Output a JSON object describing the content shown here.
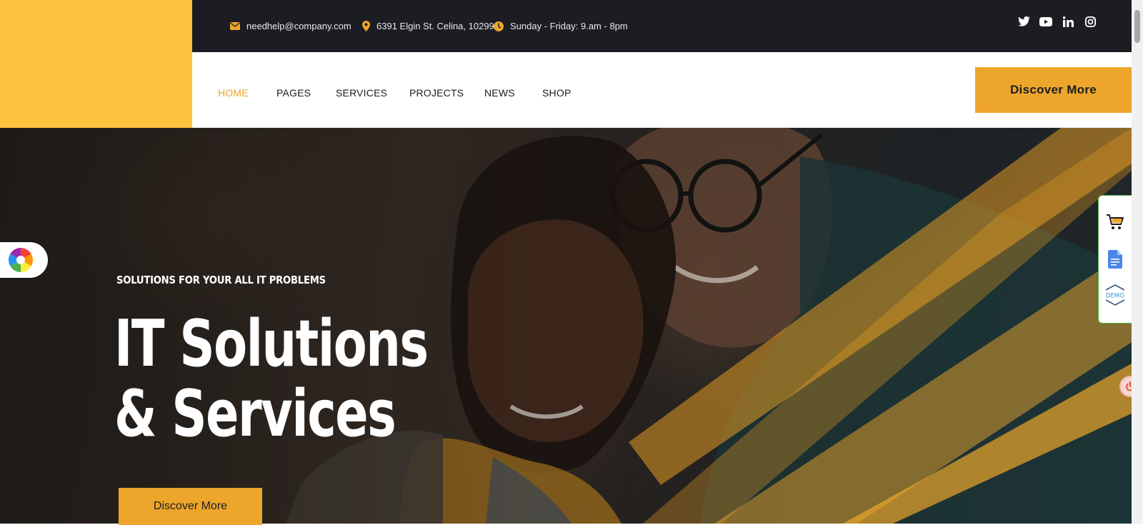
{
  "topbar": {
    "email": "needhelp@company.com",
    "address": "6391 Elgin St. Celina, 10299",
    "hours": "Sunday - Friday: 9.am - 8pm",
    "social": [
      "twitter-icon",
      "youtube-icon",
      "linkedin-icon",
      "instagram-icon"
    ]
  },
  "nav": {
    "items": [
      {
        "label": "HOME",
        "active": true
      },
      {
        "label": "PAGES",
        "active": false
      },
      {
        "label": "SERVICES",
        "active": false
      },
      {
        "label": "PROJECTS",
        "active": false
      },
      {
        "label": "NEWS",
        "active": false
      },
      {
        "label": "SHOP",
        "active": false
      }
    ],
    "cta_label": "Discover More"
  },
  "hero": {
    "tagline": "SOLUTIONS FOR YOUR ALL IT PROBLEMS",
    "title_line1": "IT Solutions",
    "title_line2": "& Services",
    "cta_label": "Discover More"
  },
  "widgets": {
    "demo_label": "DEMO",
    "side_icons": [
      "cart-icon",
      "document-icon",
      "demo-icon"
    ]
  },
  "colors": {
    "accent": "#eda62b",
    "logo_bg": "#fdc33f",
    "topbar_bg": "#1c1d22",
    "active_link": "#e9a22a"
  }
}
